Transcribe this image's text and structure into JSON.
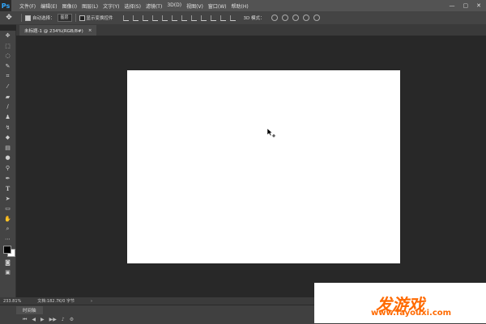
{
  "app": {
    "logo": "Ps"
  },
  "menubar": {
    "items": [
      "文件(F)",
      "编辑(E)",
      "图像(I)",
      "图层(L)",
      "文字(Y)",
      "选择(S)",
      "滤镜(T)",
      "3D(D)",
      "视图(V)",
      "窗口(W)",
      "帮助(H)"
    ],
    "window_controls": [
      "—",
      "▢",
      "✕"
    ]
  },
  "options": {
    "auto_select_label": "自动选择：",
    "auto_select_value": "图层",
    "show_transform_label": "显示变换控件",
    "mode_3d_label": "3D 模式："
  },
  "document": {
    "tab_title": "未标题-1 @ 234%(RGB/8#)",
    "tab_close": "×"
  },
  "status": {
    "zoom": "233.81%",
    "doc_info": "文档:182.7K/0 字节"
  },
  "timeline": {
    "tab_label": "时间轴"
  },
  "watermark": {
    "brand": "发游戏",
    "url": "www.fayouxi.com"
  },
  "colors": {
    "foreground": "#000000",
    "background": "#ffffff",
    "accent": "#31a8ff"
  }
}
